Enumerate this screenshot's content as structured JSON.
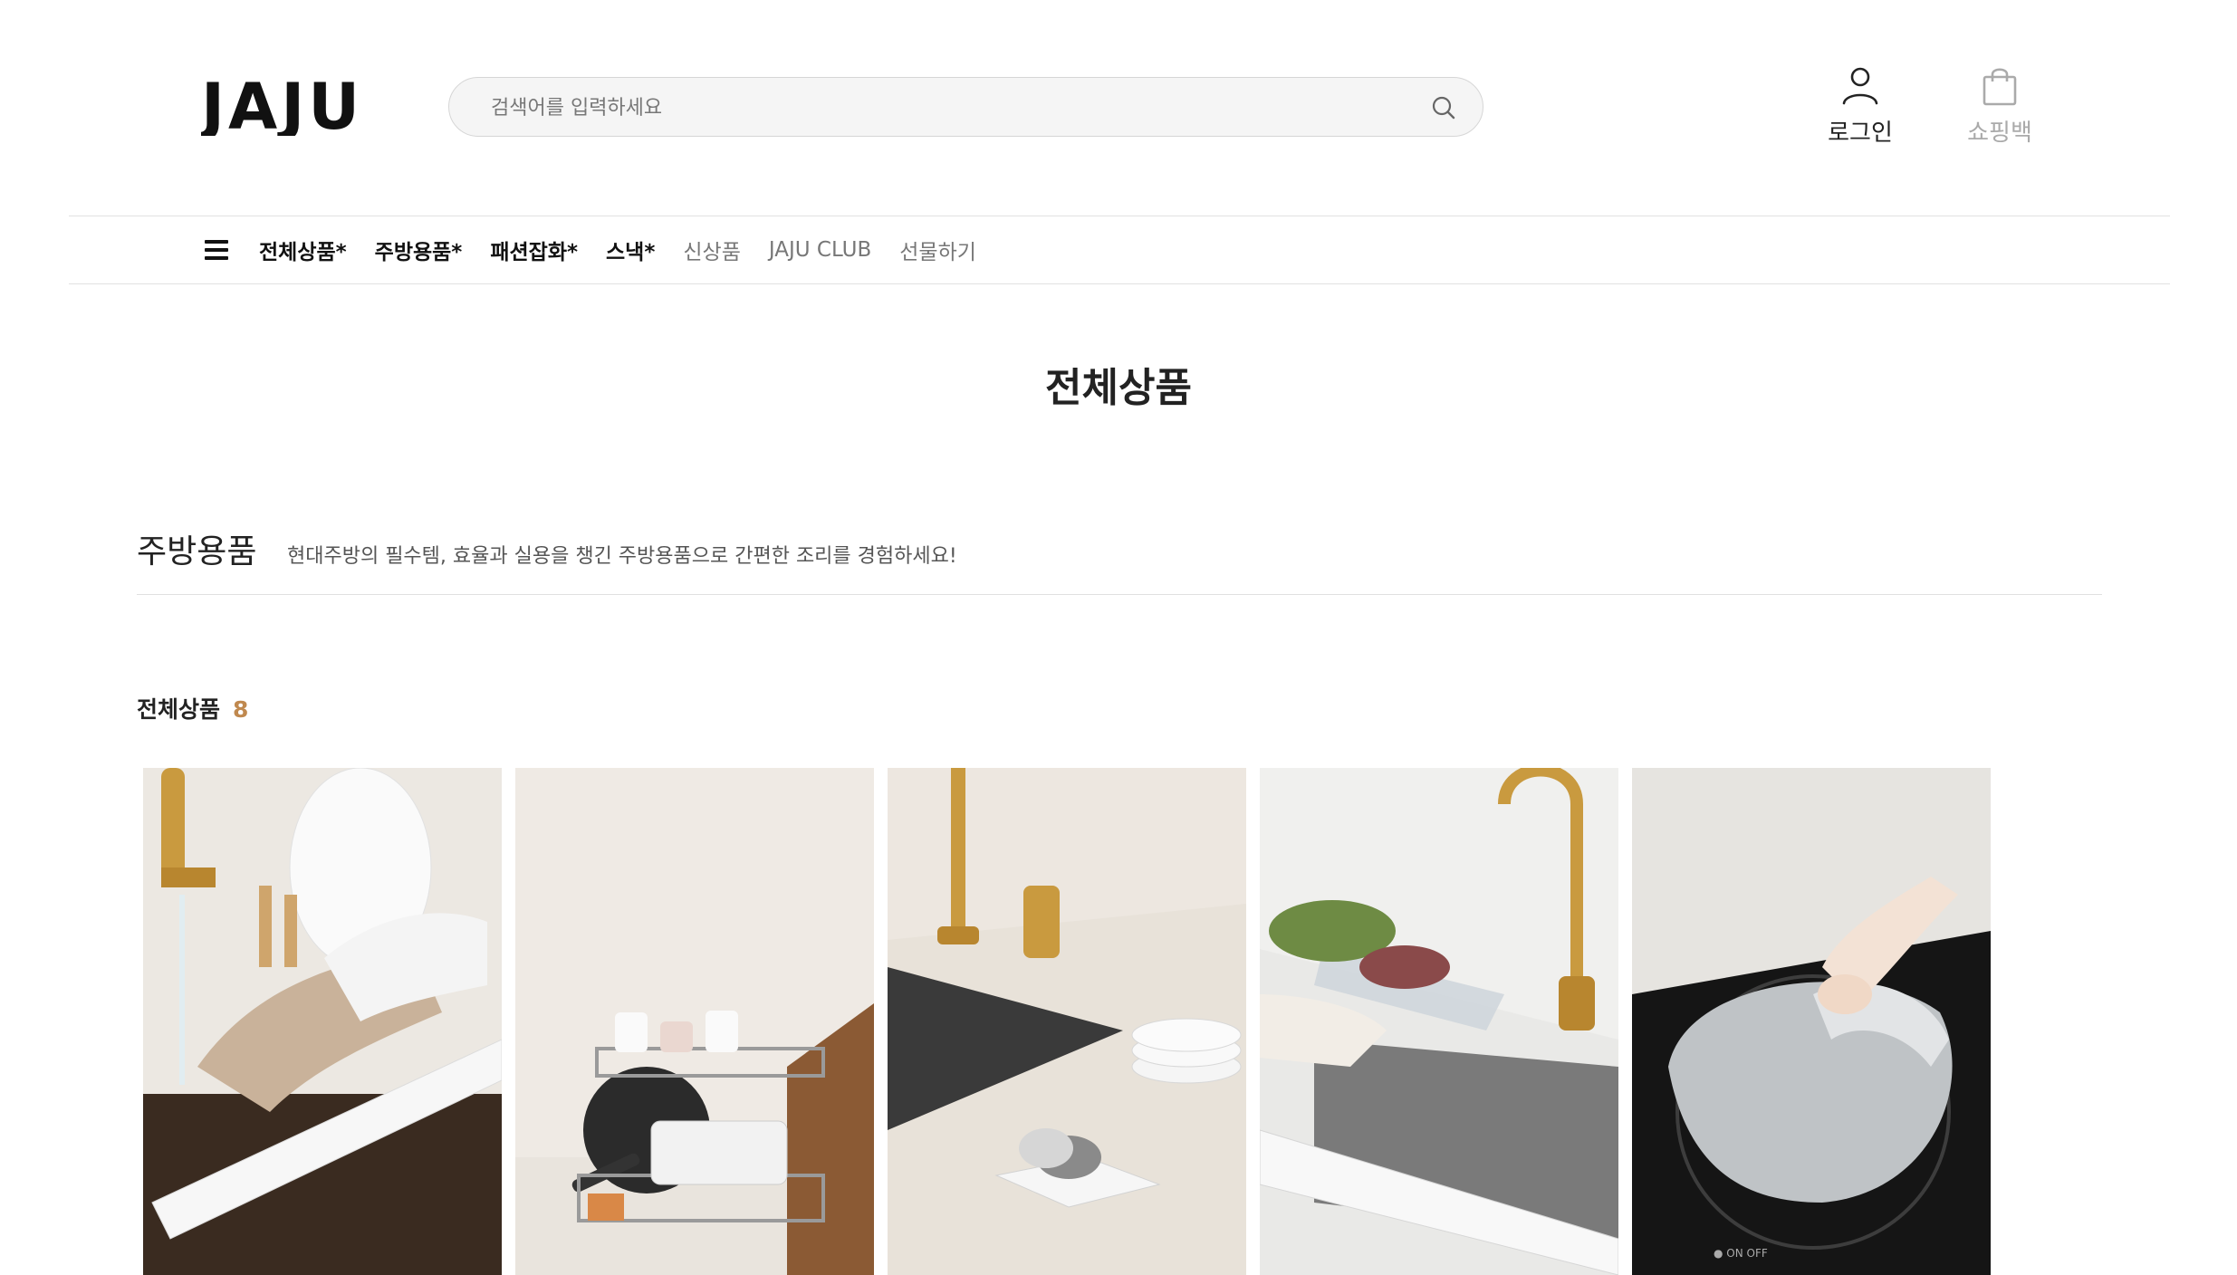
{
  "brand": {
    "logo_text": "JAJU"
  },
  "search": {
    "placeholder": "검색어를 입력하세요"
  },
  "utilities": {
    "login_label": "로그인",
    "cart_label": "쇼핑백"
  },
  "nav": {
    "items": [
      {
        "label": "전체상품*",
        "style": "bold"
      },
      {
        "label": "주방용품*",
        "style": "bold"
      },
      {
        "label": "패션잡화*",
        "style": "bold"
      },
      {
        "label": "스낵*",
        "style": "bold"
      },
      {
        "label": "신상품",
        "style": "light"
      },
      {
        "label": "JAJU CLUB",
        "style": "light"
      },
      {
        "label": "선물하기",
        "style": "light"
      }
    ]
  },
  "page": {
    "title": "전체상품"
  },
  "category": {
    "title": "주방용품",
    "description": "현대주방의 필수템, 효율과 실용을 챙긴 주방용품으로 간편한 조리를 경험하세요!"
  },
  "listing": {
    "label": "전체상품",
    "count": "8"
  },
  "products": [
    {
      "image": "sink-splash-guard-with-gloves"
    },
    {
      "image": "two-tier-dish-rack"
    },
    {
      "image": "soap-dish-with-scrubber"
    },
    {
      "image": "sink-splash-guard-with-drain-tray"
    },
    {
      "image": "induction-cooktop-protector-mat"
    }
  ],
  "colors": {
    "accent": "#c0894f",
    "text": "#222222",
    "muted": "#777777"
  }
}
